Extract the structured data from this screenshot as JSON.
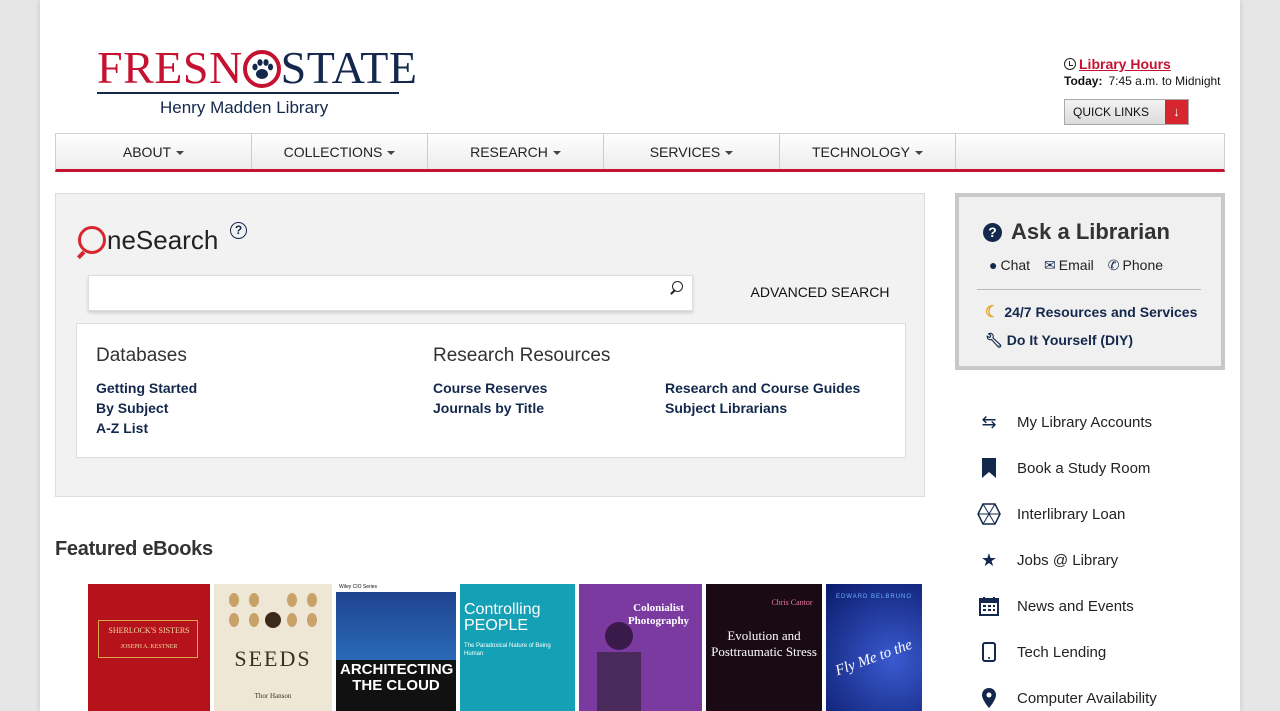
{
  "header": {
    "logo_title_left": "FRESN",
    "logo_title_right": "STATE",
    "logo_subtitle": "Henry Madden Library",
    "hours_link": "Library Hours",
    "today_label": "Today:",
    "today_hours": "7:45 a.m. to Midnight",
    "quick_links": "QUICK LINKS"
  },
  "nav": [
    {
      "label": "ABOUT"
    },
    {
      "label": "COLLECTIONS"
    },
    {
      "label": "RESEARCH"
    },
    {
      "label": "SERVICES"
    },
    {
      "label": "TECHNOLOGY"
    }
  ],
  "search": {
    "brand": "neSearch",
    "help": "?",
    "value": "",
    "placeholder": "",
    "advanced": "ADVANCED SEARCH"
  },
  "resources": {
    "databases_heading": "Databases",
    "databases": [
      "Getting Started",
      "By Subject",
      "A-Z List"
    ],
    "research_heading": "Research Resources",
    "research_col1": [
      "Course Reserves",
      "Journals by Title"
    ],
    "research_col2": [
      "Research and Course Guides",
      "Subject Librarians"
    ]
  },
  "ask": {
    "title": "Ask a Librarian",
    "chat": "Chat",
    "email": "Email",
    "phone": "Phone",
    "resources_247": "24/7 Resources and Services",
    "diy": "Do It Yourself (DIY)"
  },
  "side_links": [
    {
      "label": "My Library Accounts",
      "icon": "exchange-icon"
    },
    {
      "label": "Book a Study Room",
      "icon": "bookmark-icon"
    },
    {
      "label": "Interlibrary Loan",
      "icon": "globe-icon"
    },
    {
      "label": "Jobs @ Library",
      "icon": "star-icon"
    },
    {
      "label": "News and Events",
      "icon": "calendar-icon"
    },
    {
      "label": "Tech Lending",
      "icon": "tablet-icon"
    },
    {
      "label": "Computer Availability",
      "icon": "map-marker-icon"
    }
  ],
  "featured": {
    "heading": "Featured eBooks",
    "books": [
      {
        "title": "SHERLOCK'S SISTERS",
        "author": "JOSEPH A. KESTNER",
        "color": "#b5121b"
      },
      {
        "title": "SEEDS",
        "author": "Thor Hanson",
        "color": "#efe7d6"
      },
      {
        "title": "ARCHITECTING THE CLOUD",
        "series": "Wiley CIO Series",
        "color": "#1e3f8a"
      },
      {
        "title": "Controlling PEOPLE",
        "subtitle": "The Paradoxical Nature of Being Human",
        "color": "#14a0b5"
      },
      {
        "title": "Colonialist Photography",
        "color": "#7a3aa0"
      },
      {
        "title": "Evolution and Posttraumatic Stress",
        "author": "Chris Cantor",
        "color": "#1a0a14"
      },
      {
        "title": "Fly Me to the",
        "author": "EDWARD BELBRUNO",
        "color": "#1a2a8a"
      }
    ]
  }
}
